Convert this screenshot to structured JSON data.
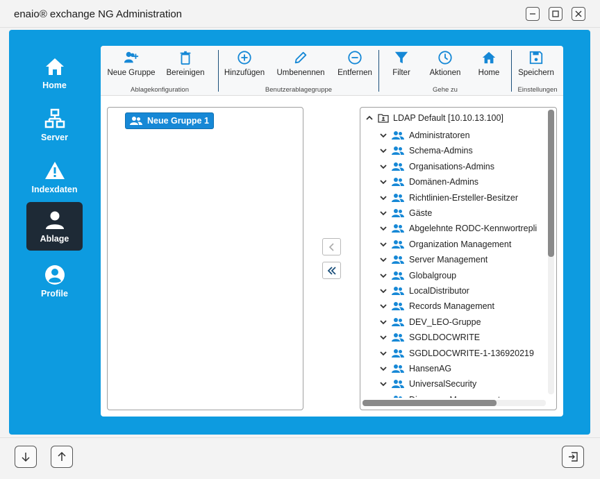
{
  "window": {
    "title": "enaio® exchange NG Administration"
  },
  "nav": {
    "items": [
      {
        "label": "Home",
        "icon": "home-icon"
      },
      {
        "label": "Server",
        "icon": "network-icon"
      },
      {
        "label": "Indexdaten",
        "icon": "warning-icon"
      },
      {
        "label": "Ablage",
        "icon": "person-icon",
        "active": true
      },
      {
        "label": "Profile",
        "icon": "profile-icon"
      }
    ]
  },
  "ribbon": {
    "buttons": [
      {
        "label": "Neue Gruppe",
        "icon": "add-group-icon"
      },
      {
        "label": "Bereinigen",
        "icon": "trash-icon"
      },
      {
        "label": "Hinzufügen",
        "icon": "plus-circle-icon"
      },
      {
        "label": "Umbenennen",
        "icon": "pencil-icon"
      },
      {
        "label": "Entfernen",
        "icon": "minus-circle-icon"
      },
      {
        "label": "Filter",
        "icon": "filter-icon"
      },
      {
        "label": "Aktionen",
        "icon": "clock-icon"
      },
      {
        "label": "Home",
        "icon": "home-icon"
      },
      {
        "label": "Speichern",
        "icon": "save-icon"
      }
    ],
    "groups": [
      "Ablagekonfiguration",
      "Benutzerablagegruppe",
      "Gehe zu",
      "Einstellungen"
    ]
  },
  "left_list": {
    "items": [
      "Neue Gruppe 1"
    ]
  },
  "tree": {
    "root": "LDAP Default  [10.10.13.100]",
    "items": [
      "Administratoren",
      "Schema-Admins",
      "Organisations-Admins",
      "Domänen-Admins",
      "Richtlinien-Ersteller-Besitzer",
      "Gäste",
      "Abgelehnte RODC-Kennwortrepli",
      "Organization Management",
      "Server Management",
      "Globalgroup",
      "LocalDistributor",
      "Records Management",
      "DEV_LEO-Gruppe",
      "SGDLDOCWRITE",
      "SGDLDOCWRITE-1-136920219",
      "HansenAG",
      "UniversalSecurity",
      "Discovery Management"
    ]
  },
  "colors": {
    "accent": "#0d9be0",
    "icon_blue": "#1688d6",
    "nav_active": "#1e2a36"
  }
}
